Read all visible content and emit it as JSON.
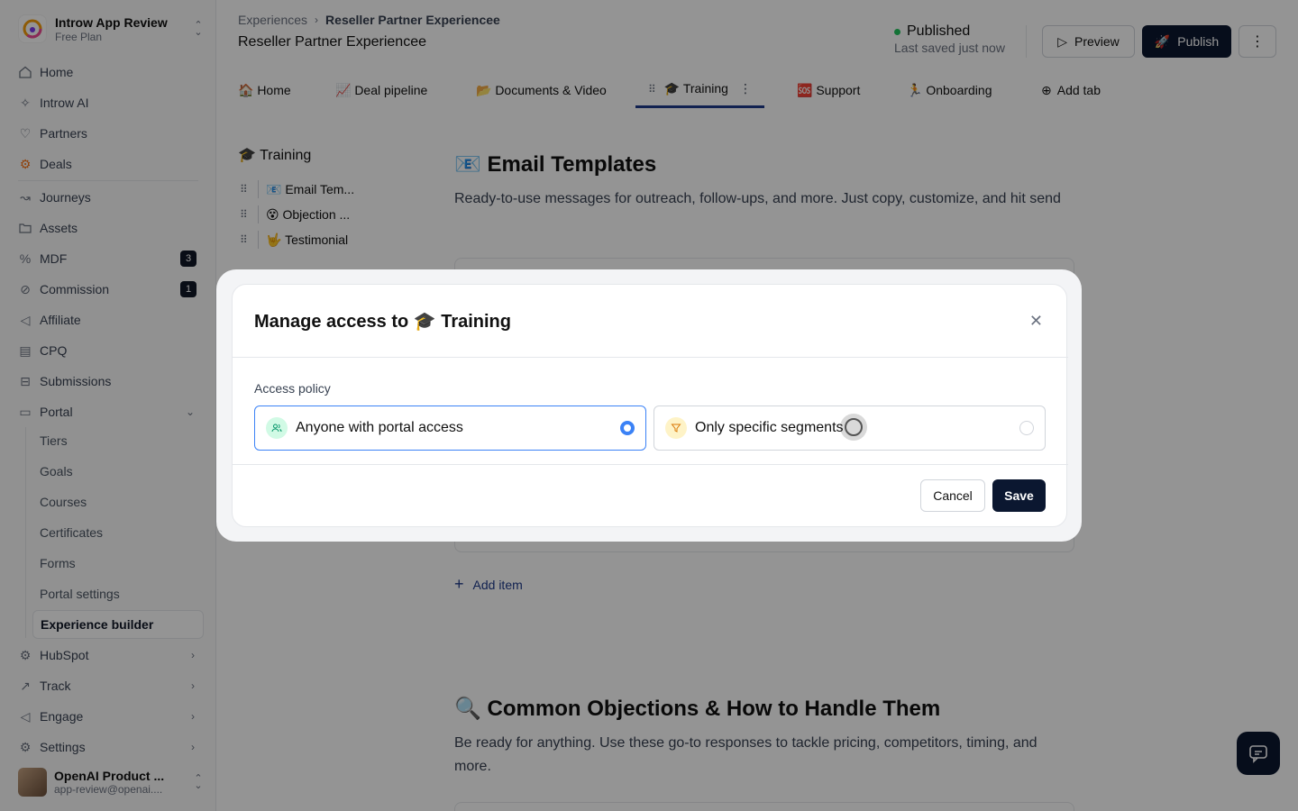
{
  "brand": {
    "name": "Introw App Review",
    "plan": "Free Plan"
  },
  "nav": [
    {
      "label": "Home",
      "icon": "home-icon"
    },
    {
      "label": "Introw AI",
      "icon": "sparkle-icon"
    },
    {
      "label": "Partners",
      "icon": "handshake-icon"
    },
    {
      "label": "Deals",
      "icon": "hubspot-icon"
    },
    {
      "label": "Journeys",
      "icon": "route-icon"
    },
    {
      "label": "Assets",
      "icon": "folder-icon"
    },
    {
      "label": "MDF",
      "icon": "percent-icon",
      "badge": "3"
    },
    {
      "label": "Commission",
      "icon": "coins-icon",
      "badge": "1"
    },
    {
      "label": "Affiliate",
      "icon": "megaphone-icon"
    },
    {
      "label": "CPQ",
      "icon": "calculator-icon"
    },
    {
      "label": "Submissions",
      "icon": "inbox-icon"
    },
    {
      "label": "Portal",
      "icon": "monitor-icon"
    }
  ],
  "portal_sub": [
    "Tiers",
    "Goals",
    "Courses",
    "Certificates",
    "Forms",
    "Portal settings",
    "Experience builder"
  ],
  "nav_bottom": [
    {
      "label": "HubSpot",
      "icon": "hubspot-icon"
    },
    {
      "label": "Track",
      "icon": "chart-icon"
    },
    {
      "label": "Engage",
      "icon": "megaphone-icon"
    },
    {
      "label": "Settings",
      "icon": "gear-icon"
    }
  ],
  "user": {
    "name": "OpenAI Product ...",
    "email": "app-review@openai...."
  },
  "breadcrumb": {
    "parent": "Experiences",
    "current": "Reseller Partner Experiencee"
  },
  "page_title": "Reseller Partner Experiencee",
  "status": {
    "label": "Published",
    "saved": "Last saved just now"
  },
  "buttons": {
    "preview": "Preview",
    "publish": "Publish"
  },
  "tabs": [
    {
      "label": "🏠 Home"
    },
    {
      "label": "📈 Deal pipeline"
    },
    {
      "label": "📂 Documents & Video"
    },
    {
      "label": "🎓 Training",
      "active": true
    },
    {
      "label": "🆘 Support"
    },
    {
      "label": "🏃 Onboarding"
    },
    {
      "label": "Add tab"
    }
  ],
  "outline": {
    "title": "🎓 Training",
    "items": [
      "📧 Email Tem...",
      "😵 Objection ...",
      "🤟 Testimonial"
    ]
  },
  "sections": [
    {
      "title": "📧 Email Templates",
      "desc": "Ready-to-use messages for outreach, follow-ups, and more. Just copy, customize, and hit send"
    },
    {
      "title": "🔍 Common Objections & How to Handle Them",
      "desc": "Be ready for anything. Use these go-to responses to tackle pricing, competitors, timing, and more."
    }
  ],
  "add_item": "Add item",
  "modal": {
    "title": "Manage access to 🎓 Training",
    "policy_label": "Access policy",
    "options": [
      {
        "label": "Anyone with portal access",
        "selected": true,
        "icon": "users-icon"
      },
      {
        "label": "Only specific segments",
        "selected": false,
        "icon": "filter-icon"
      }
    ],
    "cancel": "Cancel",
    "save": "Save"
  },
  "colors": {
    "accent": "#3b82f6",
    "primary": "#0b1730",
    "published": "#22c55e"
  }
}
